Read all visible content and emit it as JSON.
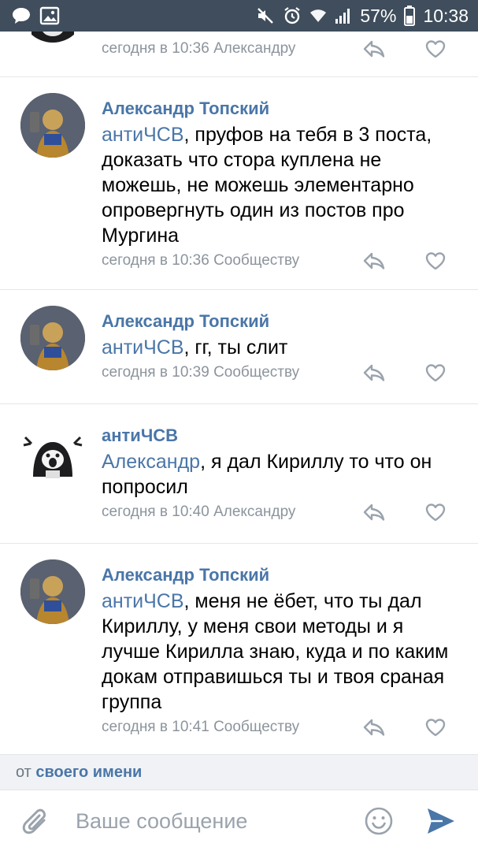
{
  "status_bar": {
    "battery": "57%",
    "time": "10:38"
  },
  "comments": [
    {
      "author": "",
      "mention": "",
      "text": "",
      "meta": "сегодня в 10:36 Александру",
      "avatar": "antichsv-avatar"
    },
    {
      "author": "Александр Топский",
      "mention": "антиЧСВ",
      "text": ", пруфов на тебя в 3 поста, доказать что стора куплена не можешь, не можешь элементарно опровергнуть один из постов про Мургина",
      "meta": "сегодня в 10:36 Сообществу",
      "avatar": "warrior-avatar"
    },
    {
      "author": "Александр Топский",
      "mention": "антиЧСВ",
      "text": ", гг, ты слит",
      "meta": "сегодня в 10:39 Сообществу",
      "avatar": "warrior-avatar"
    },
    {
      "author": "антиЧСВ",
      "mention": "Александр",
      "text": ", я дал Кириллу то что он попросил",
      "meta": "сегодня в 10:40 Александру",
      "avatar": "antichsv-avatar"
    },
    {
      "author": "Александр Топский",
      "mention": "антиЧСВ",
      "text": ", меня не ёбет, что ты дал Кириллу, у меня свои методы и я лучше Кирилла знаю, куда и по каким докам отправишься ты и твоя сраная группа",
      "meta": "сегодня в 10:41 Сообществу",
      "avatar": "warrior-avatar"
    }
  ],
  "sender": {
    "prefix": "от",
    "name": "своего имени"
  },
  "composer": {
    "placeholder": "Ваше сообщение",
    "value": ""
  },
  "colors": {
    "status_bar": "#3f4d5c",
    "link": "#4a76a8",
    "meta": "#8c949c",
    "send": "#4a76a8"
  }
}
